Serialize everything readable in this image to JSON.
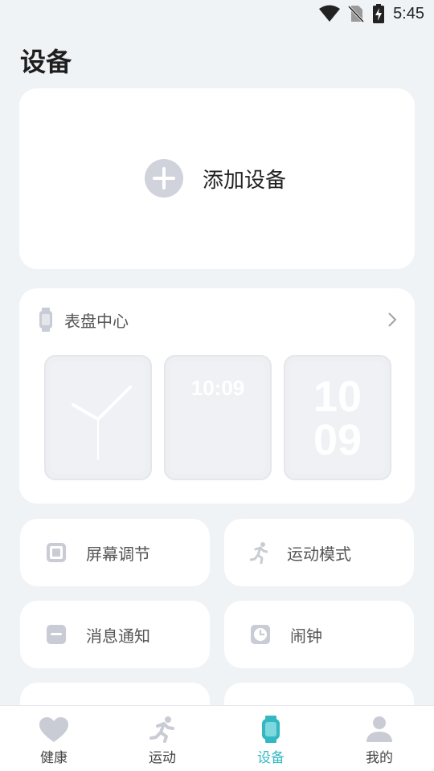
{
  "status": {
    "time": "5:45"
  },
  "header": {
    "title": "设备"
  },
  "add_device": {
    "label": "添加设备"
  },
  "watch_faces": {
    "title": "表盘中心",
    "faces": [
      {
        "name": "analog"
      },
      {
        "name": "digital",
        "time": "10:09"
      },
      {
        "name": "big-digits",
        "hours": "10",
        "minutes": "09"
      }
    ]
  },
  "tiles": [
    {
      "label": "屏幕调节",
      "icon": "screen-icon"
    },
    {
      "label": "运动模式",
      "icon": "running-icon"
    },
    {
      "label": "消息通知",
      "icon": "message-icon"
    },
    {
      "label": "闹钟",
      "icon": "alarm-clock-icon"
    }
  ],
  "nav": {
    "items": [
      {
        "label": "健康",
        "icon": "heart-icon"
      },
      {
        "label": "运动",
        "icon": "running-icon"
      },
      {
        "label": "设备",
        "icon": "watch-icon",
        "active": true
      },
      {
        "label": "我的",
        "icon": "user-icon"
      }
    ]
  },
  "colors": {
    "accent": "#33b8c1",
    "background": "#f0f3f6",
    "icon_gray": "#c9ccd4"
  }
}
